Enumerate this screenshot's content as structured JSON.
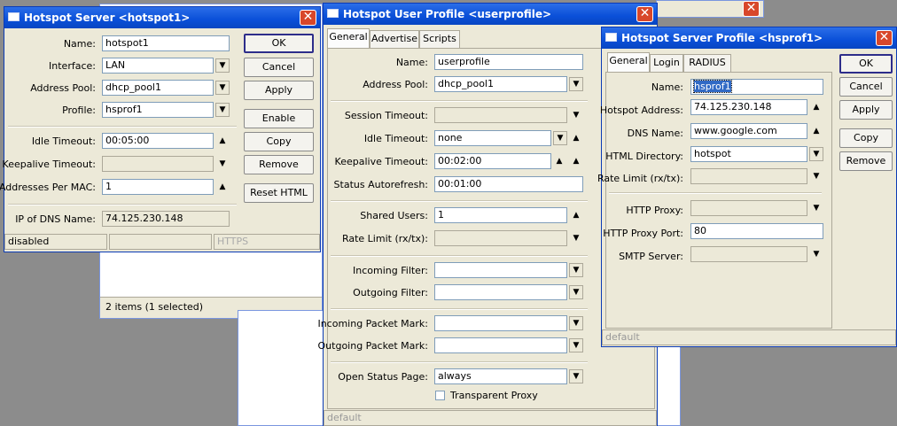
{
  "hotspot_server": {
    "title": "Hotspot Server <hotspot1>",
    "fields": [
      {
        "label": "Name:",
        "value": "hotspot1"
      },
      {
        "label": "Interface:",
        "value": "LAN"
      },
      {
        "label": "Address Pool:",
        "value": "dhcp_pool1"
      },
      {
        "label": "Profile:",
        "value": "hsprof1"
      },
      {
        "label": "Idle Timeout:",
        "value": "00:05:00"
      },
      {
        "label": "Keepalive Timeout:",
        "value": ""
      },
      {
        "label": "Addresses Per MAC:",
        "value": "1"
      },
      {
        "label": "IP of DNS Name:",
        "value": "74.125.230.148"
      }
    ],
    "buttons": [
      "OK",
      "Cancel",
      "Apply",
      "Enable",
      "Copy",
      "Remove",
      "Reset HTML"
    ],
    "status": [
      "disabled",
      "",
      "HTTPS"
    ]
  },
  "background_list": {
    "status": "2 items (1 selected)"
  },
  "user_profile": {
    "title": "Hotspot User Profile <userprofile>",
    "tabs": [
      "General",
      "Advertise",
      "Scripts"
    ],
    "fields": [
      {
        "label": "Name:",
        "value": "userprofile"
      },
      {
        "label": "Address Pool:",
        "value": "dhcp_pool1"
      },
      {
        "label": "Session Timeout:",
        "value": ""
      },
      {
        "label": "Idle Timeout:",
        "value": "none"
      },
      {
        "label": "Keepalive Timeout:",
        "value": "00:02:00"
      },
      {
        "label": "Status Autorefresh:",
        "value": "00:01:00"
      },
      {
        "label": "Shared Users:",
        "value": "1"
      },
      {
        "label": "Rate Limit (rx/tx):",
        "value": ""
      },
      {
        "label": "Incoming Filter:",
        "value": ""
      },
      {
        "label": "Outgoing Filter:",
        "value": ""
      },
      {
        "label": "Incoming Packet Mark:",
        "value": ""
      },
      {
        "label": "Outgoing Packet Mark:",
        "value": ""
      },
      {
        "label": "Open Status Page:",
        "value": "always"
      }
    ],
    "transparent_proxy_label": "Transparent Proxy",
    "status": "default"
  },
  "server_profile": {
    "title": "Hotspot Server Profile <hsprof1>",
    "tabs": [
      "General",
      "Login",
      "RADIUS"
    ],
    "fields": [
      {
        "label": "Name:",
        "value": "hsprof1"
      },
      {
        "label": "Hotspot Address:",
        "value": "74.125.230.148"
      },
      {
        "label": "DNS Name:",
        "value": "www.google.com"
      },
      {
        "label": "HTML Directory:",
        "value": "hotspot"
      },
      {
        "label": "Rate Limit (rx/tx):",
        "value": ""
      },
      {
        "label": "HTTP Proxy:",
        "value": ""
      },
      {
        "label": "HTTP Proxy Port:",
        "value": "80"
      },
      {
        "label": "SMTP Server:",
        "value": ""
      }
    ],
    "buttons": [
      "OK",
      "Cancel",
      "Apply",
      "Copy",
      "Remove"
    ],
    "status": "default"
  }
}
